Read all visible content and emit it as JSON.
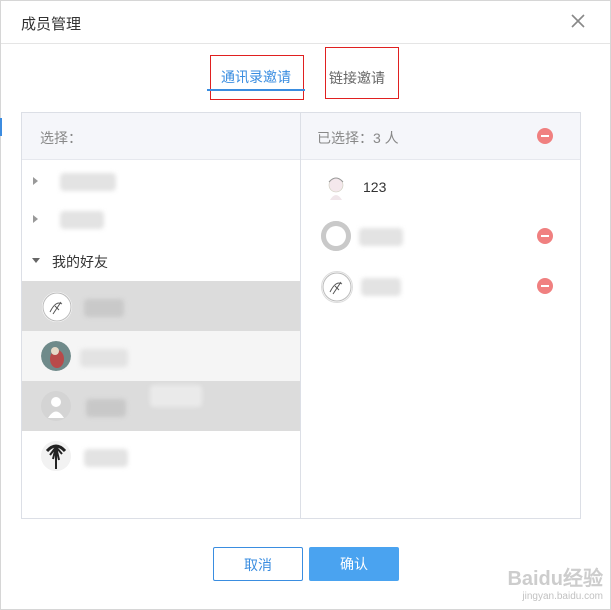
{
  "dialog": {
    "title": "成员管理"
  },
  "tabs": [
    {
      "label": "通讯录邀请",
      "active": true
    },
    {
      "label": "链接邀请",
      "active": false
    }
  ],
  "left": {
    "header": "选择：",
    "groups": [
      {
        "label": "",
        "expanded": false
      },
      {
        "label": "",
        "expanded": false
      },
      {
        "label": "我的好友",
        "expanded": true
      }
    ],
    "friends": [
      {
        "name": "",
        "selected": true
      },
      {
        "name": "",
        "selected": false
      },
      {
        "name": "",
        "selected": true
      },
      {
        "name": "",
        "selected": false
      }
    ]
  },
  "right": {
    "header": "已选择：3 人",
    "selected": [
      {
        "name": "123",
        "removable": false
      },
      {
        "name": "",
        "removable": true
      },
      {
        "name": "",
        "removable": true
      }
    ]
  },
  "buttons": {
    "cancel": "取消",
    "confirm": "确认"
  },
  "watermark": {
    "brand": "Baidu经验",
    "url": "jingyan.baidu.com"
  },
  "colors": {
    "accent": "#3a8de0",
    "remove": "#f08080",
    "selected_row": "#dcdcdc",
    "highlight_box": "#e02020"
  }
}
